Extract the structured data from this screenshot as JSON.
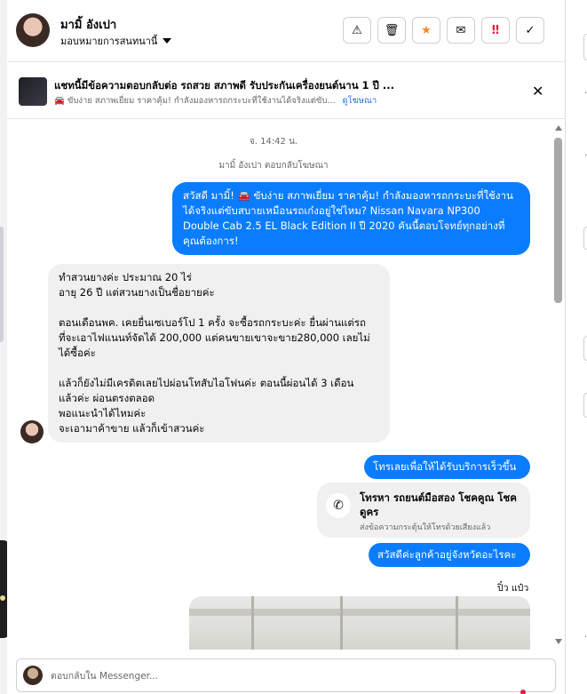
{
  "header": {
    "contact_name": "มามิ้ อังเปา",
    "assign_label": "มอบหมายการสนทนานี้",
    "actions": [
      {
        "name": "spam",
        "glyph": "⚠"
      },
      {
        "name": "delete",
        "glyph": "🗑"
      },
      {
        "name": "star",
        "glyph": "★"
      },
      {
        "name": "mark-unread",
        "glyph": "✉"
      },
      {
        "name": "follow-up",
        "glyph": "‼"
      },
      {
        "name": "done",
        "glyph": "✓"
      }
    ]
  },
  "ad_banner": {
    "title": "แชทนี้มีข้อความตอบกลับต่อ รถสวย สภาพดี รับประกันเครื่องยนต์นาน 1 ปี ...",
    "subtitle": "🚘 ขับง่าย สภาพเยี่ยม ราคาคุ้ม! กำลังมองหารถกระบะที่ใช้งานได้จริงแต่ขับ...",
    "link": "ดูโฆษณา",
    "close_glyph": "✕"
  },
  "thread": {
    "timestamp": "จ. 14:42 น.",
    "reply_note": "มามิ้ อังเปา ตอบกลับโฆษณา",
    "messages": {
      "ad_greeting_1": "สวัสดี มามิ้! 🚘 ขับง่าย สภาพเยี่ยม ราคาคุ้ม! กำลังมองหารถกระบะที่ใช้งาน",
      "ad_greeting_2": "ได้จริงแต่ขับสบายเหมือนรถเก๋งอยู่ใช่ไหม? Nissan Navara NP300",
      "ad_greeting_3": "Double Cab 2.5 EL Black Edition II ปี 2020 คันนี้ตอบโจทย์ทุกอย่างที่",
      "ad_greeting_4": "คุณต้องการ!",
      "customer_p1_l1": "ทำสวนยางค่ะ ประมาณ 20 ไร่",
      "customer_p1_l2": "อายุ 26 ปี แต่สวนยางเป็นชื่อยายค่ะ",
      "customer_p2_l1": "ตอนเดือนพค. เคยยื่นเซเบอร์โป 1 ครั้ง จะซื้อรถกระบะค่ะ ยื่นผ่านแต่รถ",
      "customer_p2_l2": "ที่จะเอาไฟแนนท์จัดได้ 200,000 แต่คนขายเขาจะขาย280,000 เลยไม่",
      "customer_p2_l3": "ได้ซื้อค่ะ",
      "customer_p3_l1": "แล้วก็ยังไม่มีเครดิตเลยไปผ่อนโทสับไอโฟนค่ะ ตอนนี้ผ่อนได้ 3 เดือน",
      "customer_p3_l2": "แล้วค่ะ ผ่อนตรงตลอด",
      "customer_p3_l3": "พอแนะนำได้ไหมค่ะ",
      "customer_p3_l4": "จะเอามาค้าขาย แล้วก็เข้าสวนค่ะ",
      "call_prompt": "โทรเลยเพื่อให้ได้รับบริการเร็วขึ้น",
      "reply_greeting": "สวัสดีค่ะลูกค้าอยู่จังหวัดอะไรคะ"
    },
    "call_card": {
      "icon": "phone-icon",
      "title": "โทรหา รถยนต์มือสอง โชคคูณ โชค ดูคร",
      "subtitle": "ส่งข้อความกระตุ้นให้โทรด้วยเสียงแล้ว"
    },
    "sender_label": "ปิ๋ว แป๋ว"
  },
  "composer": {
    "placeholder": "ตอบกลับใน Messenger..."
  },
  "colors": {
    "outgoing_bubble": "#0a7cff",
    "incoming_bubble": "#f0f0f0",
    "link": "#216fdb",
    "star": "#f28b2b",
    "urgent": "#e41e3f"
  }
}
